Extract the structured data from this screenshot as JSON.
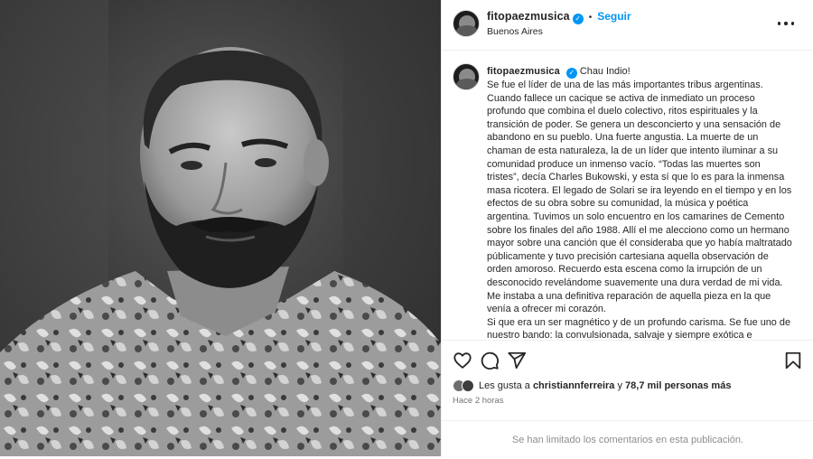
{
  "post": {
    "username": "fitopaezmusica",
    "verified_mark": "✓",
    "separator": "•",
    "follow_label": "Seguir",
    "location": "Buenos Aires"
  },
  "caption": {
    "username": "fitopaezmusica",
    "lines": [
      "Chau Indio!",
      "Se fue el líder de una de las más importantes tribus argentinas. Cuando fallece un cacique se activa de inmediato un proceso profundo que combina el duelo colectivo, ritos espirituales y la transición de poder. Se genera un desconcierto y una sensación de abandono en su pueblo. Una fuerte angustia. La muerte de un chaman de esta naturaleza, la de un líder que intento iluminar a su comunidad produce un inmenso vacío. “Todas las muertes son tristes”, decía Charles Bukowski, y esta sí que lo es para la inmensa masa ricotera. El legado de Solari se ira leyendo en el tiempo y en los efectos de su obra sobre su comunidad, la música y poética argentina. Tuvimos un solo encuentro en los camarines de Cemento sobre los finales del año 1988. Allí el me alecciono como un hermano mayor sobre una canción que él consideraba que yo había maltratado públicamente y tuvo precisión cartesiana aquella observación de orden amoroso. Recuerdo esta escena como la irrupción de un desconocido revelándome suavemente una dura verdad de mi vida. Me instaba a una definitiva reparación de aquella pieza en la que venía a ofrecer mi corazón.",
      "Si que era un ser magnético y de un profundo carisma. Se fue uno de nuestro bando: la convulsionada, salvaje y siempre exótica e imprevisible cultura rock."
    ]
  },
  "actions": {
    "like_icon": "heart-icon",
    "comment_icon": "comment-icon",
    "share_icon": "share-icon",
    "save_icon": "bookmark-icon"
  },
  "likes": {
    "prefix": "Les gusta a",
    "user": "christiannferreira",
    "connector": "y",
    "count_text": "78,7 mil personas más"
  },
  "timestamp": "Hace 2 horas",
  "comments_notice": "Se han limitado los comentarios en esta publicación."
}
